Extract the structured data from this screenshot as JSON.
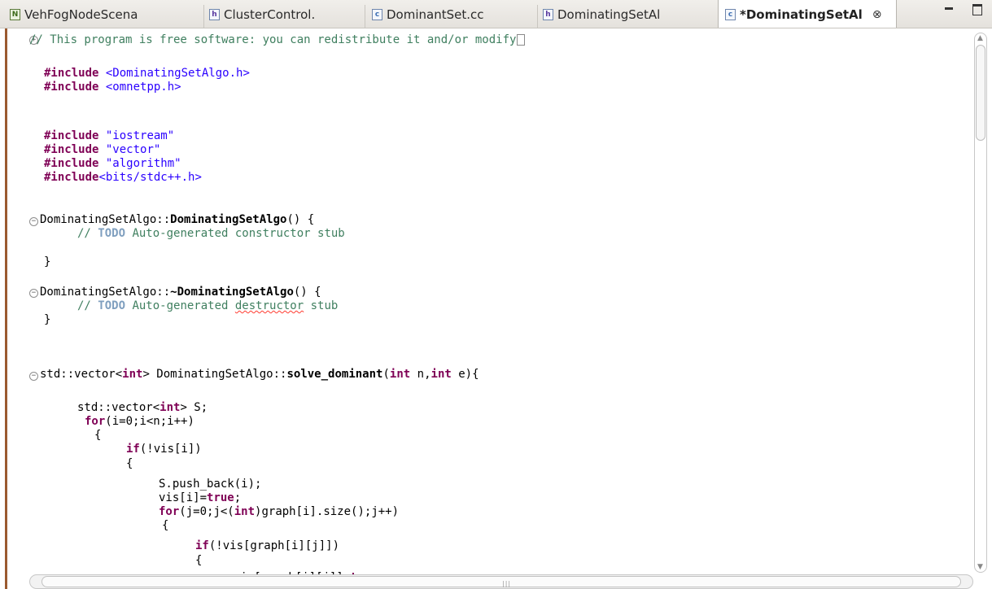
{
  "tabs": [
    {
      "label": "VehFogNodeScena",
      "icon": "ned-file-icon",
      "active": false
    },
    {
      "label": "ClusterControl.",
      "icon": "header-file-icon",
      "active": false
    },
    {
      "label": "DominantSet.cc",
      "icon": "c-source-file-icon",
      "active": false
    },
    {
      "label": "DominatingSetAl",
      "icon": "header-file-icon",
      "active": false
    },
    {
      "label": "*DominatingSetAl",
      "icon": "c-source-file-icon",
      "active": true
    }
  ],
  "tab_close_glyph": "⊗",
  "icon_letters": {
    "c": "c",
    "h": "h",
    "ned": "N"
  },
  "code": {
    "l1_comment": "// This program is free software: you can redistribute it and/or modify",
    "inc1_kw": "#include",
    "inc1_val": "<DominatingSetAlgo.h>",
    "inc2_kw": "#include",
    "inc2_val": "<omnetpp.h>",
    "inc3_kw": "#include",
    "inc3_val": "\"iostream\"",
    "inc4_kw": "#include",
    "inc4_val": "\"vector\"",
    "inc5_kw": "#include",
    "inc5_val": "\"algorithm\"",
    "inc6_kw": "#include",
    "inc6_val": "<bits/stdc++.h>",
    "ctor_prefix": "DominatingSetAlgo::",
    "ctor_name": "DominatingSetAlgo",
    "ctor_suffix": "() {",
    "ctor_comment_a": "// ",
    "todo": "TODO",
    "ctor_comment_b": " Auto-generated constructor stub",
    "close_brace": "}",
    "dtor_prefix": "DominatingSetAlgo::",
    "dtor_name": "~DominatingSetAlgo",
    "dtor_suffix": "() {",
    "dtor_comment_a": "// ",
    "dtor_comment_b": " Auto-generated ",
    "dtor_comment_word": "destructor",
    "dtor_comment_c": " stub",
    "solve_a": "std::vector<",
    "int": "int",
    "solve_b": "> DominatingSetAlgo::",
    "solve_name": "solve_dominant",
    "solve_c": "(",
    "solve_d": " n,",
    "solve_e": " e){",
    "vec_a": "std::vector<",
    "vec_b": "> S;",
    "for": "for",
    "for1_rest": "(i=0;i<n;i++)",
    "open_brace": "{",
    "if": "if",
    "if1_rest": "(!vis[i])",
    "push": "S.push_back(i);",
    "vis_a": "vis[i]=",
    "true": "true",
    "semi": ";",
    "for2_a": "(j=0;j<(",
    "for2_b": ")graph[i].size();j++)",
    "if2_rest": "(!vis[graph[i][j]])",
    "last_a": "vis[graph[i][j]]=",
    "last_b": ";"
  }
}
